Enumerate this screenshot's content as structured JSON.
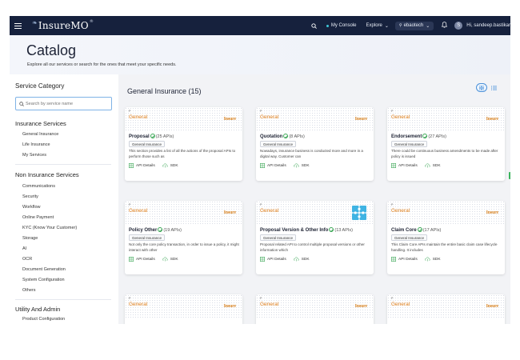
{
  "topbar": {
    "brand_name": "InsureMO",
    "brand_reg": "®",
    "console_label": "My Console",
    "explore_label": "Explore",
    "tenant_label": "ebaotech",
    "avatar_initial": "S",
    "greeting": "Hi, sandeep.bastikar"
  },
  "header": {
    "title": "Catalog",
    "subtitle": "Explore all our services or search for the ones that meet your specific needs."
  },
  "sidebar": {
    "title": "Service Category",
    "search_placeholder": "Search by service name",
    "groups": [
      {
        "label": "Insurance Services",
        "items": [
          "General Insurance",
          "Life Insurance",
          "My Services"
        ]
      },
      {
        "label": "Non Insurance Services",
        "items": [
          "Communications",
          "Security",
          "Workflow",
          "Online Payment",
          "KYC (Know Your Customer)",
          "Storage",
          "AI",
          "OCR",
          "Document Generation",
          "System Configuration",
          "Others"
        ]
      },
      {
        "label": "Utility And Admin",
        "items": [
          "Product Configuration"
        ]
      }
    ]
  },
  "main": {
    "title": "General Insurance (15)",
    "cards": [
      {
        "p": "P",
        "category": "General",
        "logo": "Insure",
        "name": "Proposal",
        "count": "(25 APIs)",
        "tag": "General Insurance",
        "desc": "This section provides a list of all the actions of the proposal APIs to perform those such as",
        "api_label": "API Details",
        "sdk_label": "SDK"
      },
      {
        "p": "P",
        "category": "General",
        "logo": "Insure",
        "name": "Quotation",
        "count": "(8 APIs)",
        "tag": "General Insurance",
        "desc": "Nowadays, insurance business is conducted more and more in a digital way. Customer can",
        "api_label": "API Details",
        "sdk_label": "SDK"
      },
      {
        "p": "P",
        "category": "General",
        "logo": "Insure",
        "name": "Endorsement",
        "count": "(27 APIs)",
        "tag": "General Insurance",
        "desc": "There could be continuous business amendments to be made after policy is issued",
        "api_label": "API Details",
        "sdk_label": "SDK"
      },
      {
        "p": "P",
        "category": "General",
        "logo": "Insure",
        "name": "Policy Other",
        "count": "(19 APIs)",
        "tag": "General Insurance",
        "desc": "Not only the core policy transaction, in order to issue a policy, it might interact with other",
        "api_label": "API Details",
        "sdk_label": "SDK"
      },
      {
        "p": "P",
        "category": "General",
        "logo": "",
        "name": "Proposal Version & Other Info",
        "count": "(13 APIs)",
        "tag": "General Insurance",
        "desc": "Proposal related API to control multiple proposal versions or other information which",
        "api_label": "API Details",
        "sdk_label": "SDK"
      },
      {
        "p": "P",
        "category": "General",
        "logo": "Insure",
        "name": "Claim Core",
        "count": "(17 APIs)",
        "tag": "General Insurance",
        "desc": "This Claim Core APIs maintain the entire basic claim case lifecycle handling. It includes",
        "api_label": "API Details",
        "sdk_label": "SDK"
      },
      {
        "p": "P",
        "category": "General",
        "logo": "Insure"
      },
      {
        "p": "P",
        "category": "General",
        "logo": "Insure"
      },
      {
        "p": "P",
        "category": "General",
        "logo": "Insure"
      }
    ]
  },
  "colors": {
    "topbar_bg": "#16213d",
    "accent_orange": "#e07f1a",
    "check_green": "#3aa655",
    "link_blue": "#4a90d9"
  }
}
